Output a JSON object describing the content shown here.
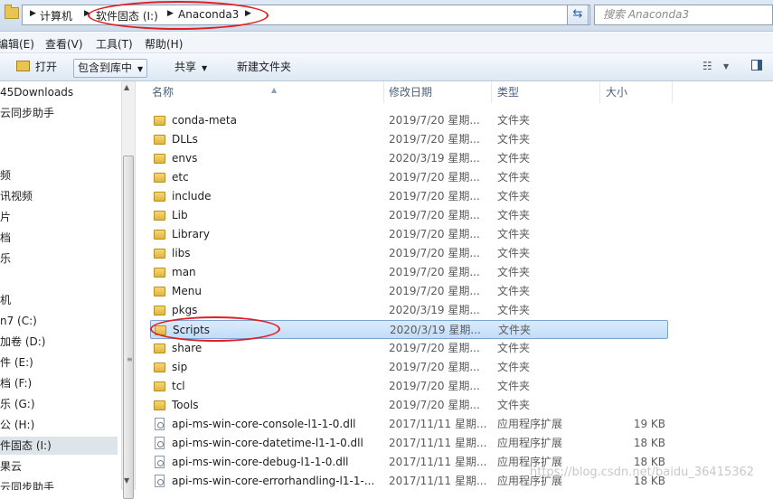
{
  "address": {
    "crumbs": [
      "计算机",
      "软件固态 (I:)",
      "Anaconda3"
    ],
    "search_placeholder": "搜索 Anaconda3"
  },
  "menubar": [
    "编辑(E)",
    "查看(V)",
    "工具(T)",
    "帮助(H)"
  ],
  "toolbar": {
    "open": "打开",
    "include_in_library": "包含到库中",
    "share": "共享",
    "new_folder": "新建文件夹"
  },
  "nav_items": [
    {
      "label": "45Downloads",
      "selected": false
    },
    {
      "label": "云同步助手",
      "selected": false
    },
    {
      "label": "",
      "selected": false
    },
    {
      "label": "",
      "selected": false
    },
    {
      "label": "频",
      "selected": false
    },
    {
      "label": "讯视频",
      "selected": false
    },
    {
      "label": "片",
      "selected": false
    },
    {
      "label": "档",
      "selected": false
    },
    {
      "label": "乐",
      "selected": false
    },
    {
      "label": "",
      "selected": false
    },
    {
      "label": "机",
      "selected": false
    },
    {
      "label": "n7 (C:)",
      "selected": false
    },
    {
      "label": "加卷 (D:)",
      "selected": false
    },
    {
      "label": "件 (E:)",
      "selected": false
    },
    {
      "label": "档 (F:)",
      "selected": false
    },
    {
      "label": "乐 (G:)",
      "selected": false
    },
    {
      "label": "公 (H:)",
      "selected": false
    },
    {
      "label": "件固态 (I:)",
      "selected": true
    },
    {
      "label": "果云",
      "selected": false
    },
    {
      "label": "云同步助手",
      "selected": false
    }
  ],
  "columns": {
    "name": "名称",
    "date": "修改日期",
    "type": "类型",
    "size": "大小"
  },
  "files": [
    {
      "name": "conda-meta",
      "date": "2019/7/20 星期...",
      "type": "文件夹",
      "size": "",
      "kind": "folder"
    },
    {
      "name": "DLLs",
      "date": "2019/7/20 星期...",
      "type": "文件夹",
      "size": "",
      "kind": "folder"
    },
    {
      "name": "envs",
      "date": "2020/3/19 星期...",
      "type": "文件夹",
      "size": "",
      "kind": "folder"
    },
    {
      "name": "etc",
      "date": "2019/7/20 星期...",
      "type": "文件夹",
      "size": "",
      "kind": "folder"
    },
    {
      "name": "include",
      "date": "2019/7/20 星期...",
      "type": "文件夹",
      "size": "",
      "kind": "folder"
    },
    {
      "name": "Lib",
      "date": "2019/7/20 星期...",
      "type": "文件夹",
      "size": "",
      "kind": "folder"
    },
    {
      "name": "Library",
      "date": "2019/7/20 星期...",
      "type": "文件夹",
      "size": "",
      "kind": "folder"
    },
    {
      "name": "libs",
      "date": "2019/7/20 星期...",
      "type": "文件夹",
      "size": "",
      "kind": "folder"
    },
    {
      "name": "man",
      "date": "2019/7/20 星期...",
      "type": "文件夹",
      "size": "",
      "kind": "folder"
    },
    {
      "name": "Menu",
      "date": "2019/7/20 星期...",
      "type": "文件夹",
      "size": "",
      "kind": "folder"
    },
    {
      "name": "pkgs",
      "date": "2020/3/19 星期...",
      "type": "文件夹",
      "size": "",
      "kind": "folder"
    },
    {
      "name": "Scripts",
      "date": "2020/3/19 星期...",
      "type": "文件夹",
      "size": "",
      "kind": "folder",
      "selected": true
    },
    {
      "name": "share",
      "date": "2019/7/20 星期...",
      "type": "文件夹",
      "size": "",
      "kind": "folder"
    },
    {
      "name": "sip",
      "date": "2019/7/20 星期...",
      "type": "文件夹",
      "size": "",
      "kind": "folder"
    },
    {
      "name": "tcl",
      "date": "2019/7/20 星期...",
      "type": "文件夹",
      "size": "",
      "kind": "folder"
    },
    {
      "name": "Tools",
      "date": "2019/7/20 星期...",
      "type": "文件夹",
      "size": "",
      "kind": "folder"
    },
    {
      "name": "api-ms-win-core-console-l1-1-0.dll",
      "date": "2017/11/11 星期...",
      "type": "应用程序扩展",
      "size": "19 KB",
      "kind": "dll"
    },
    {
      "name": "api-ms-win-core-datetime-l1-1-0.dll",
      "date": "2017/11/11 星期...",
      "type": "应用程序扩展",
      "size": "18 KB",
      "kind": "dll"
    },
    {
      "name": "api-ms-win-core-debug-l1-1-0.dll",
      "date": "2017/11/11 星期...",
      "type": "应用程序扩展",
      "size": "18 KB",
      "kind": "dll"
    },
    {
      "name": "api-ms-win-core-errorhandling-l1-1-...",
      "date": "2017/11/11 星期...",
      "type": "应用程序扩展",
      "size": "18 KB",
      "kind": "dll"
    }
  ],
  "watermark": "https://blog.csdn.net/baidu_36415362"
}
